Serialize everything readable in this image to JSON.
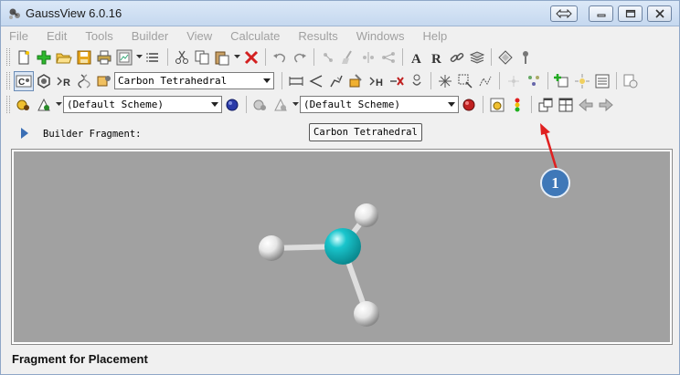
{
  "window": {
    "title": "GaussView 6.0.16"
  },
  "menu": [
    "File",
    "Edit",
    "Tools",
    "Builder",
    "View",
    "Calculate",
    "Results",
    "Windows",
    "Help"
  ],
  "toolbar2": {
    "fragment_combo": "Carbon Tetrahedral"
  },
  "toolbar3": {
    "scheme_combo_1": "(Default Scheme)",
    "scheme_combo_2": "(Default Scheme)"
  },
  "fragment": {
    "label": "Builder Fragment:",
    "tooltip": "Carbon Tetrahedral"
  },
  "status": {
    "label": "Fragment for Placement"
  },
  "annotation": {
    "number": "1"
  },
  "colors": {
    "carbon": "#19c5cc",
    "hydrogen": "#e8e8e8",
    "viewport_bg": "#a1a1a1",
    "callout": "#3f78b8",
    "arrow": "#e02020"
  }
}
